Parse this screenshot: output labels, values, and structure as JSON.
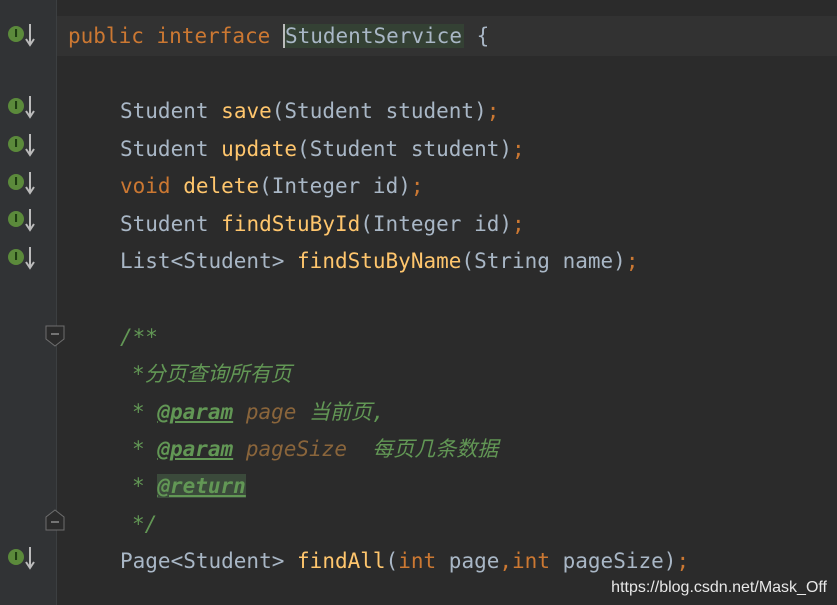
{
  "code": {
    "l1": {
      "kw1": "public",
      "kw2": "interface",
      "name": "StudentService",
      "brace": "{"
    },
    "l2": {
      "type": "Student",
      "fn": "save",
      "open": "(",
      "ptype": "Student",
      "pname": "student",
      "close": ")",
      "semi": ";"
    },
    "l3": {
      "type": "Student",
      "fn": "update",
      "open": "(",
      "ptype": "Student",
      "pname": "student",
      "close": ")",
      "semi": ";"
    },
    "l4": {
      "type": "void",
      "fn": "delete",
      "open": "(",
      "ptype": "Integer",
      "pname": "id",
      "close": ")",
      "semi": ";"
    },
    "l5": {
      "type": "Student",
      "fn": "findStuById",
      "open": "(",
      "ptype": "Integer",
      "pname": "id",
      "close": ")",
      "semi": ";"
    },
    "l6": {
      "type": "List<Student>",
      "fn": "findStuByName",
      "open": "(",
      "ptype": "String",
      "pname": "name",
      "close": ")",
      "semi": ";"
    },
    "doc": {
      "start": "/**",
      "line1": "*分页查询所有页",
      "star": "*",
      "param_tag": "@param",
      "p1_name": "page",
      "p1_desc": "当前页,",
      "p2_name": "pageSize",
      "p2_desc": "每页几条数据",
      "return_tag": "@return",
      "end": "*/"
    },
    "l7": {
      "type": "Page<Student>",
      "fn": "findAll",
      "open": "(",
      "t1": "int",
      "p1": "page",
      "comma": ",",
      "t2": "int",
      "p2": "pageSize",
      "close": ")",
      "semi": ";"
    }
  },
  "gutter": {
    "impl_icon": "implemented-icon",
    "impl_letter": "I"
  },
  "watermark": "https://blog.csdn.net/Mask_Off",
  "colors": {
    "background": "#2b2b2b",
    "keyword": "#cc7832",
    "method": "#ffc66d",
    "identifier": "#a9b7c6",
    "doc_comment": "#629755"
  }
}
